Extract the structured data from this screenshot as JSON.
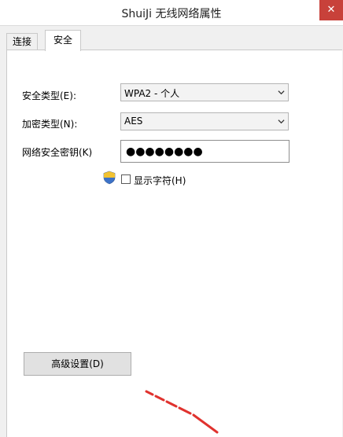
{
  "window": {
    "title": "ShuiJi 无线网络属性",
    "close_glyph": "✕"
  },
  "tabs": [
    {
      "label": "连接"
    },
    {
      "label": "安全",
      "selected": true
    }
  ],
  "security": {
    "security_type_label": "安全类型(E):",
    "security_type_value": "WPA2 - 个人",
    "encryption_type_label": "加密类型(N):",
    "encryption_type_value": "AES",
    "network_key_label": "网络安全密钥(K)",
    "network_key_value": "●●●●●●●●",
    "show_characters_label": "显示字符(H)",
    "show_characters_checked": false
  },
  "buttons": {
    "advanced_settings": "高级设置(D)"
  },
  "colors": {
    "accent_close": "#c8413a"
  }
}
